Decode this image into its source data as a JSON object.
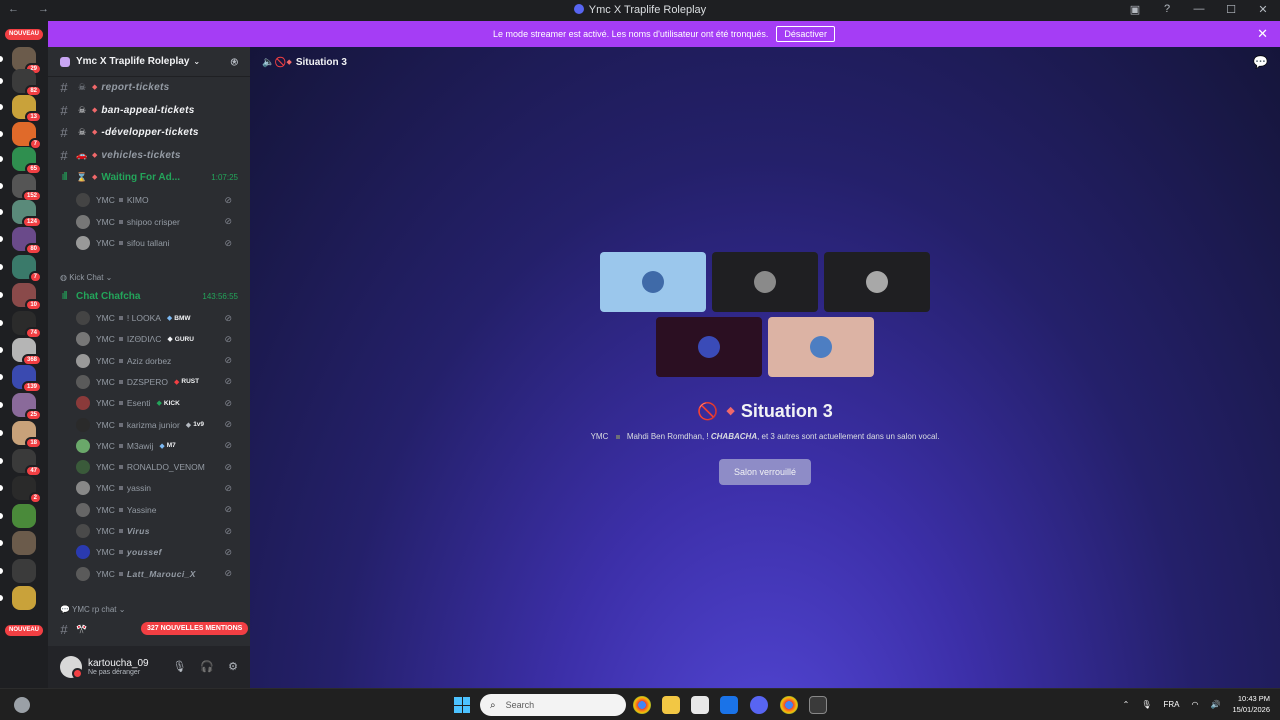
{
  "window": {
    "title": "Ymc X Traplife Roleplay",
    "nav": "← →"
  },
  "banner": {
    "text": "Le mode streamer est activé. Les noms d'utilisateur ont été tronqués.",
    "button": "Désactiver"
  },
  "guild_rail": {
    "top_label": "NOUVEAU",
    "bottom_label": "NOUVEAU",
    "badges": [
      "29",
      "82",
      "13",
      "7",
      "65",
      "152",
      "124",
      "80",
      "7",
      "10",
      "74",
      "368",
      "139",
      "25",
      "18",
      "47",
      "2"
    ]
  },
  "server": {
    "name": "Ymc X Traplife Roleplay",
    "channels": [
      {
        "name": "report-tickets"
      },
      {
        "name": "ban-appeal-tickets"
      },
      {
        "name": "-développer-tickets"
      },
      {
        "name": "vehicles-tickets"
      }
    ],
    "voice_waiting": {
      "name": "Waiting For Ad...",
      "time": "1:07:25"
    },
    "waiting_users": [
      {
        "prefix": "YMC",
        "name": "KIMO"
      },
      {
        "prefix": "YMC",
        "name": "shipoo crisper"
      },
      {
        "prefix": "YMC",
        "name": "sifou tallani"
      }
    ],
    "category_kick": "Kick Chat",
    "voice_chat": {
      "name": "Chat Chafcha",
      "time": "143:56:55"
    },
    "chat_users": [
      {
        "prefix": "YMC",
        "name": "! LOOKA",
        "tag": "BMW"
      },
      {
        "prefix": "YMC",
        "name": "IZΘDIΛC",
        "tag": "GURU"
      },
      {
        "prefix": "YMC",
        "name": "Aziz dorbez",
        "tag": ""
      },
      {
        "prefix": "YMC",
        "name": "DZSPERO",
        "tag": "RUST"
      },
      {
        "prefix": "YMC",
        "name": "Esenti",
        "tag": "KICK"
      },
      {
        "prefix": "YMC",
        "name": "karizma junior",
        "tag": "1v9"
      },
      {
        "prefix": "YMC",
        "name": "M3awij",
        "tag": "M7"
      },
      {
        "prefix": "YMC",
        "name": "RONALDO_VENOM",
        "tag": ""
      },
      {
        "prefix": "YMC",
        "name": "yassin",
        "tag": ""
      },
      {
        "prefix": "YMC",
        "name": "Yassine",
        "tag": ""
      },
      {
        "prefix": "YMC",
        "name": "Virus",
        "tag": ""
      },
      {
        "prefix": "YMC",
        "name": "youssef",
        "tag": ""
      },
      {
        "prefix": "YMC",
        "name": "Latt_Marouci_X",
        "tag": ""
      }
    ],
    "category_rp": "YMC rp chat",
    "mentions": "327 NOUVELLES MENTIONS"
  },
  "user_panel": {
    "username": "kartoucha_09",
    "status": "Ne pas déranger"
  },
  "voice_stage": {
    "channel": "Situation 3",
    "subtitle_prefix": "YMC",
    "subtitle_names": "Mahdi Ben Romdhan, !",
    "subtitle_bold": "CHABACHA",
    "subtitle_rest": ", et 3 autres sont actuellement dans un salon vocal.",
    "button": "Salon verrouillé",
    "tiles": [
      "#9bc7ec",
      "#1f1f22",
      "#1f1f22",
      "#2b0f22",
      "#dcb3a4"
    ]
  },
  "taskbar": {
    "search_placeholder": "Search",
    "lang": "FRA",
    "time": "10:43 PM",
    "date": "15/01/2026"
  }
}
